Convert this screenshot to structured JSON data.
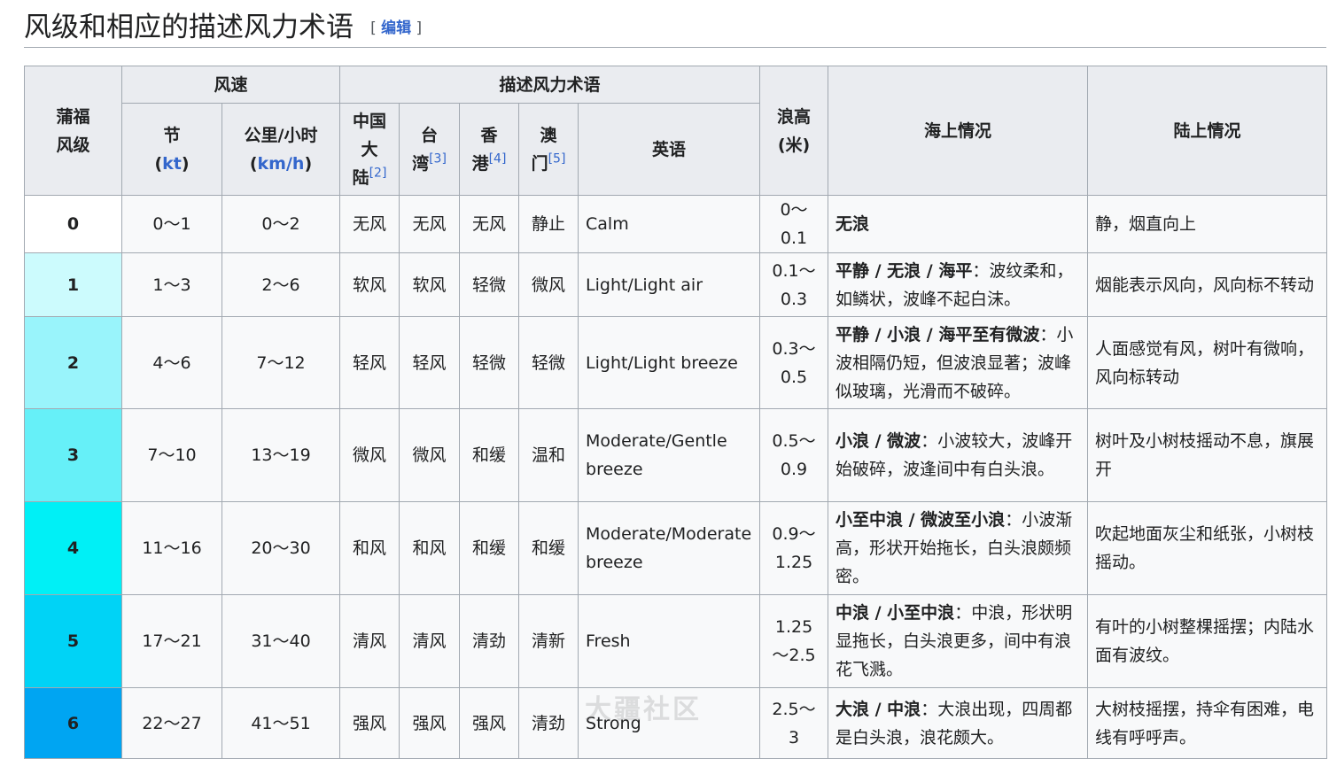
{
  "section": {
    "title": "风级和相应的描述风力术语",
    "edit_open": "[",
    "edit_label": "编辑",
    "edit_close": "]"
  },
  "headers": {
    "beaufort": [
      "蒲福",
      "风级"
    ],
    "speed_group": "风速",
    "knots": "节",
    "knots_unit": "kt",
    "kmh": "公里/小时",
    "kmh_unit": "km/h",
    "terms_group": "描述风力术语",
    "mainland": [
      "中国",
      "大",
      "陆"
    ],
    "mainland_ref": "[2]",
    "taiwan": [
      "台",
      "湾"
    ],
    "taiwan_ref": "[3]",
    "hongkong": [
      "香",
      "港"
    ],
    "hongkong_ref": "[4]",
    "macau": [
      "澳",
      "门"
    ],
    "macau_ref": "[5]",
    "english": "英语",
    "wave": [
      "浪高",
      "(米)"
    ],
    "sea": "海上情况",
    "land": "陆上情况"
  },
  "rows": [
    {
      "level": "0",
      "color": "#ffffff",
      "kt": "0～1",
      "kmh": "0～2",
      "cn": "无风",
      "tw": "无风",
      "hk": "无风",
      "mo": "静止",
      "en": "Calm",
      "wave": "0～0.1",
      "sea_bold": "无浪",
      "sea": "",
      "land": "静，烟直向上"
    },
    {
      "level": "1",
      "color": "#ccfbfd",
      "kt": "1～3",
      "kmh": "2～6",
      "cn": "软风",
      "tw": "软风",
      "hk": "轻微",
      "mo": "微风",
      "en": "Light/Light air",
      "wave": "0.1～0.3",
      "sea_bold": "平静 / 无浪 / 海平",
      "sea": "：波纹柔和，如鳞状，波峰不起白沫。",
      "land": "烟能表示风向，风向标不转动"
    },
    {
      "level": "2",
      "color": "#99f4fb",
      "kt": "4～6",
      "kmh": "7～12",
      "cn": "轻风",
      "tw": "轻风",
      "hk": "轻微",
      "mo": "轻微",
      "en": "Light/Light breeze",
      "wave": "0.3～0.5",
      "sea_bold": "平静 / 小浪 / 海平至有微波",
      "sea": "：小波相隔仍短，但波浪显著；波峰似玻璃，光滑而不破碎。",
      "land": "人面感觉有风，树叶有微响，风向标转动"
    },
    {
      "level": "3",
      "color": "#66f0f8",
      "kt": "7～10",
      "kmh": "13～19",
      "cn": "微风",
      "tw": "微风",
      "hk": "和缓",
      "mo": "温和",
      "en": "Moderate/Gentle breeze",
      "wave": "0.5～0.9",
      "sea_bold": "小浪 / 微波",
      "sea": "：小波较大，波峰开始破碎，波逢间中有白头浪。",
      "land": "树叶及小树枝摇动不息，旗展开"
    },
    {
      "level": "4",
      "color": "#00f0f6",
      "kt": "11～16",
      "kmh": "20～30",
      "cn": "和风",
      "tw": "和风",
      "hk": "和缓",
      "mo": "和缓",
      "en": "Moderate/Moderate breeze",
      "wave": "0.9～1.25",
      "sea_bold": "小至中浪 / 微波至小浪",
      "sea": "：小波渐高，形状开始拖长，白头浪颇频密。",
      "land": "吹起地面灰尘和纸张，小树枝摇动。"
    },
    {
      "level": "5",
      "color": "#00d3f6",
      "kt": "17～21",
      "kmh": "31～40",
      "cn": "清风",
      "tw": "清风",
      "hk": "清劲",
      "mo": "清新",
      "en": "Fresh",
      "wave": "1.25～2.5",
      "sea_bold": "中浪 / 小至中浪",
      "sea": "：中浪，形状明显拖长，白头浪更多，间中有浪花飞溅。",
      "land": "有叶的小树整棵摇摆；内陆水面有波纹。"
    },
    {
      "level": "6",
      "color": "#00a5f2",
      "kt": "22～27",
      "kmh": "41～51",
      "cn": "强风",
      "tw": "强风",
      "hk": "强风",
      "mo": "清劲",
      "en": "Strong",
      "wave": "2.5～3",
      "sea_bold": "大浪 / 中浪",
      "sea": "：大浪出现，四周都是白头浪，浪花颇大。",
      "land": "大树枝摇摆，持伞有困难，电线有呼呼声。"
    }
  ],
  "watermark": "大疆社区"
}
